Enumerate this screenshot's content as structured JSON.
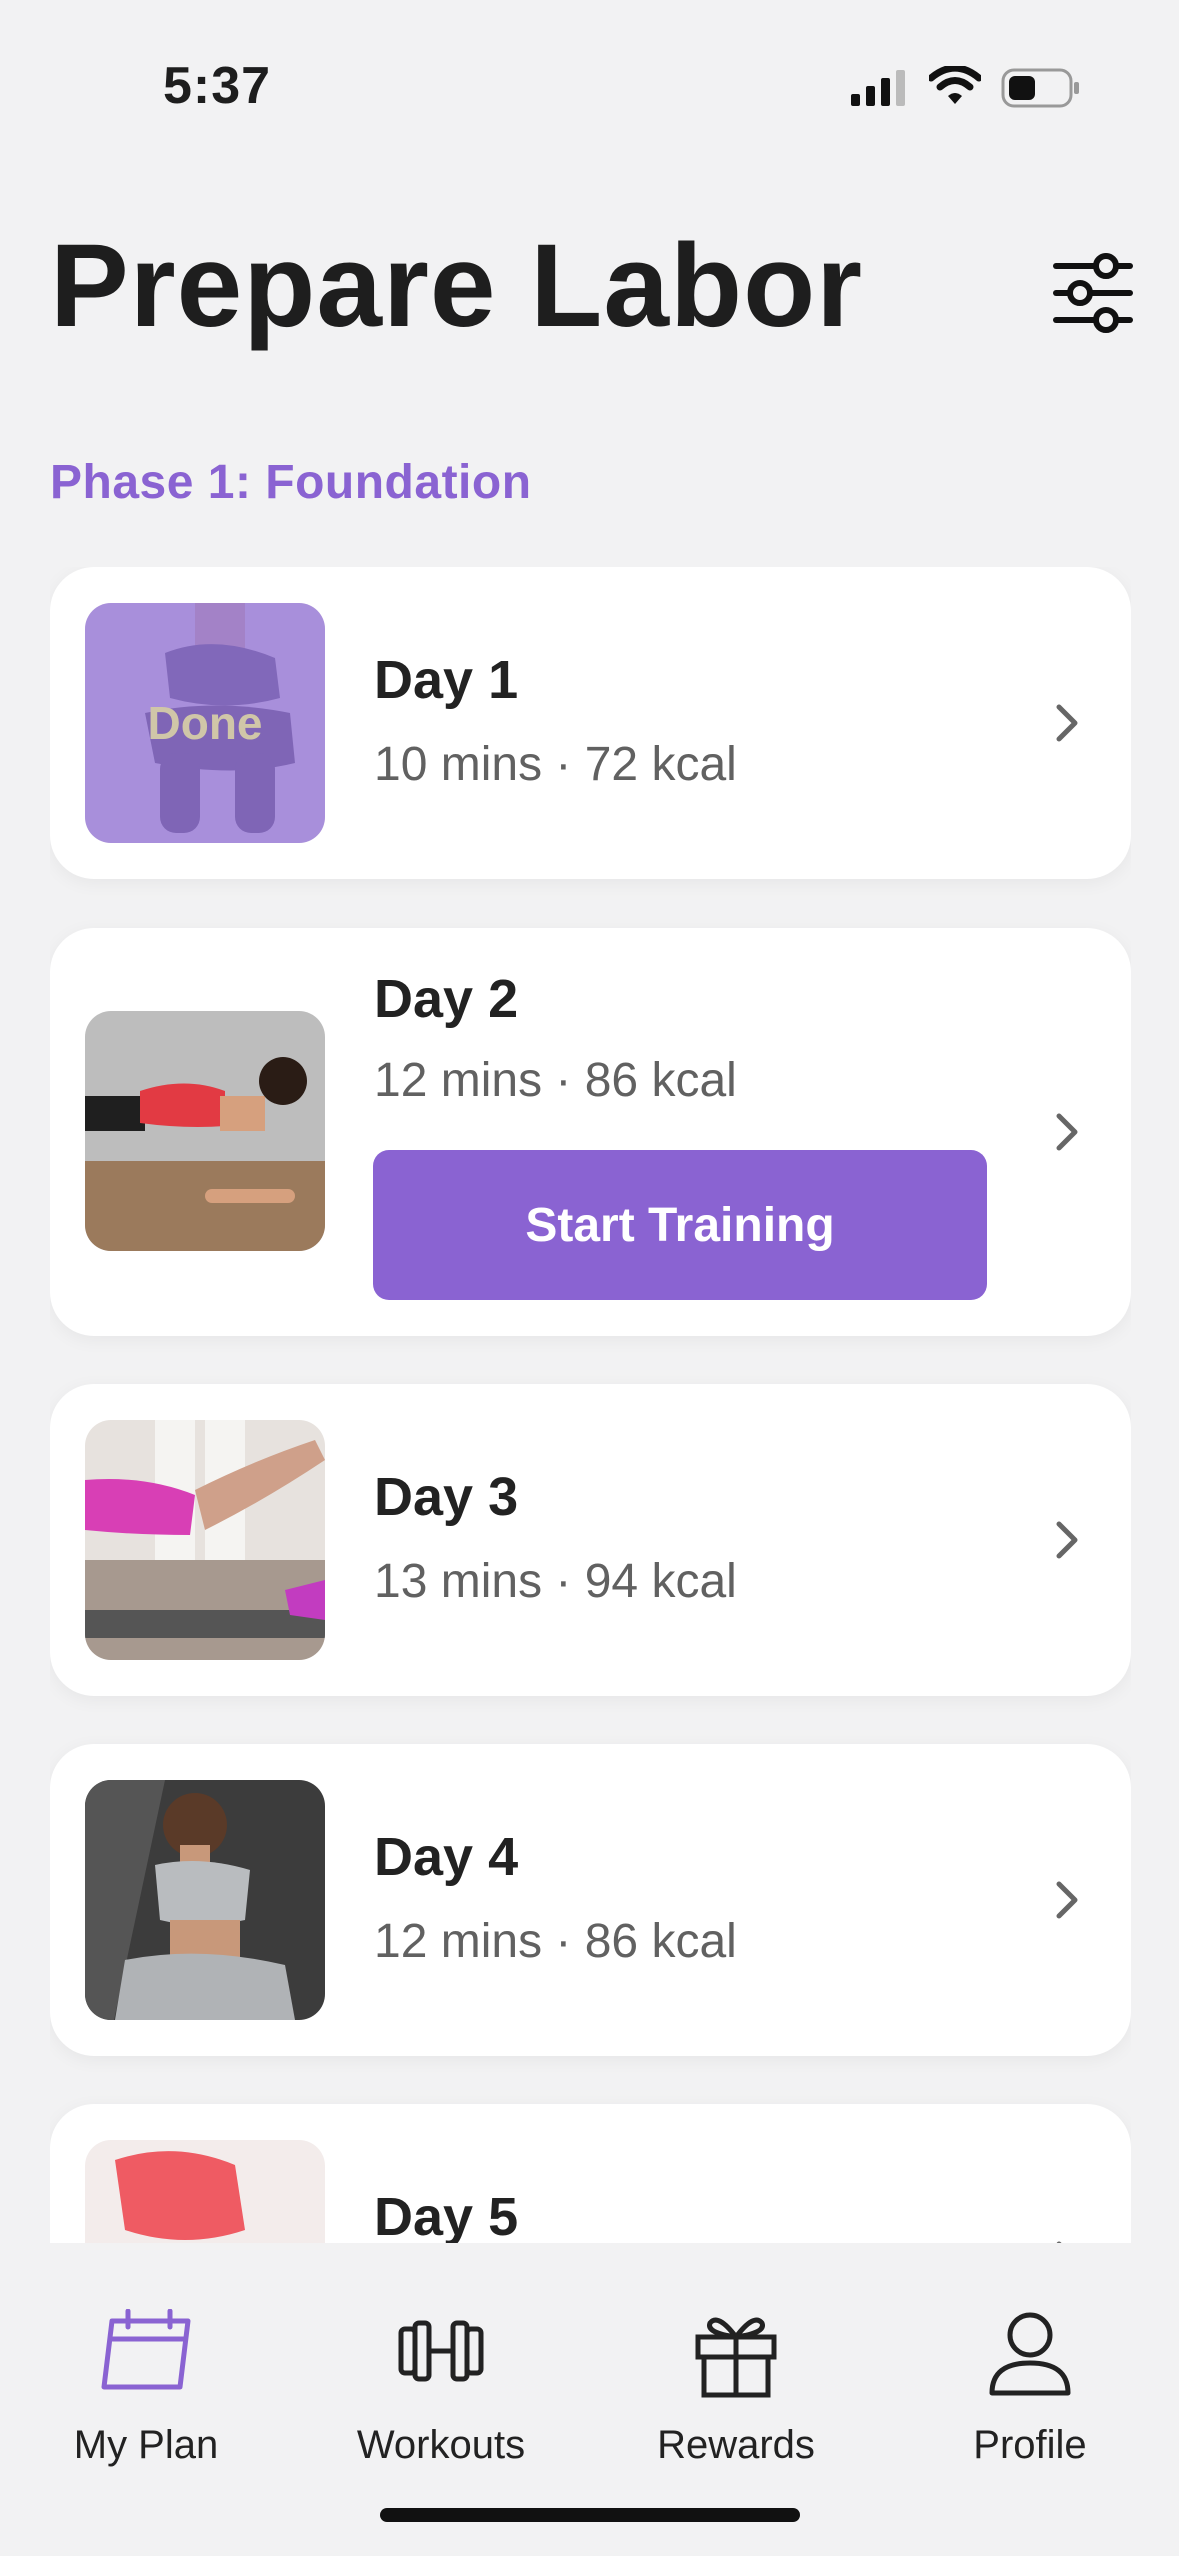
{
  "status_bar": {
    "time": "5:37"
  },
  "header": {
    "title": "Prepare Labor"
  },
  "phase": {
    "label": "Phase 1: Foundation"
  },
  "days": [
    {
      "title": "Day 1",
      "meta": "10 mins · 72 kcal",
      "status": "Done"
    },
    {
      "title": "Day 2",
      "meta": "12 mins · 86 kcal",
      "action": "Start Training"
    },
    {
      "title": "Day 3",
      "meta": "13 mins · 94 kcal"
    },
    {
      "title": "Day 4",
      "meta": "12 mins · 86 kcal"
    },
    {
      "title": "Day 5",
      "meta": ""
    }
  ],
  "tab_bar": {
    "items": [
      {
        "label": "My Plan",
        "icon": "calendar-icon",
        "active": true
      },
      {
        "label": "Workouts",
        "icon": "dumbbell-icon"
      },
      {
        "label": "Rewards",
        "icon": "gift-icon"
      },
      {
        "label": "Profile",
        "icon": "person-icon"
      }
    ]
  },
  "colors": {
    "accent": "#8a63d2",
    "background": "#f2f2f3",
    "card": "#ffffff"
  }
}
